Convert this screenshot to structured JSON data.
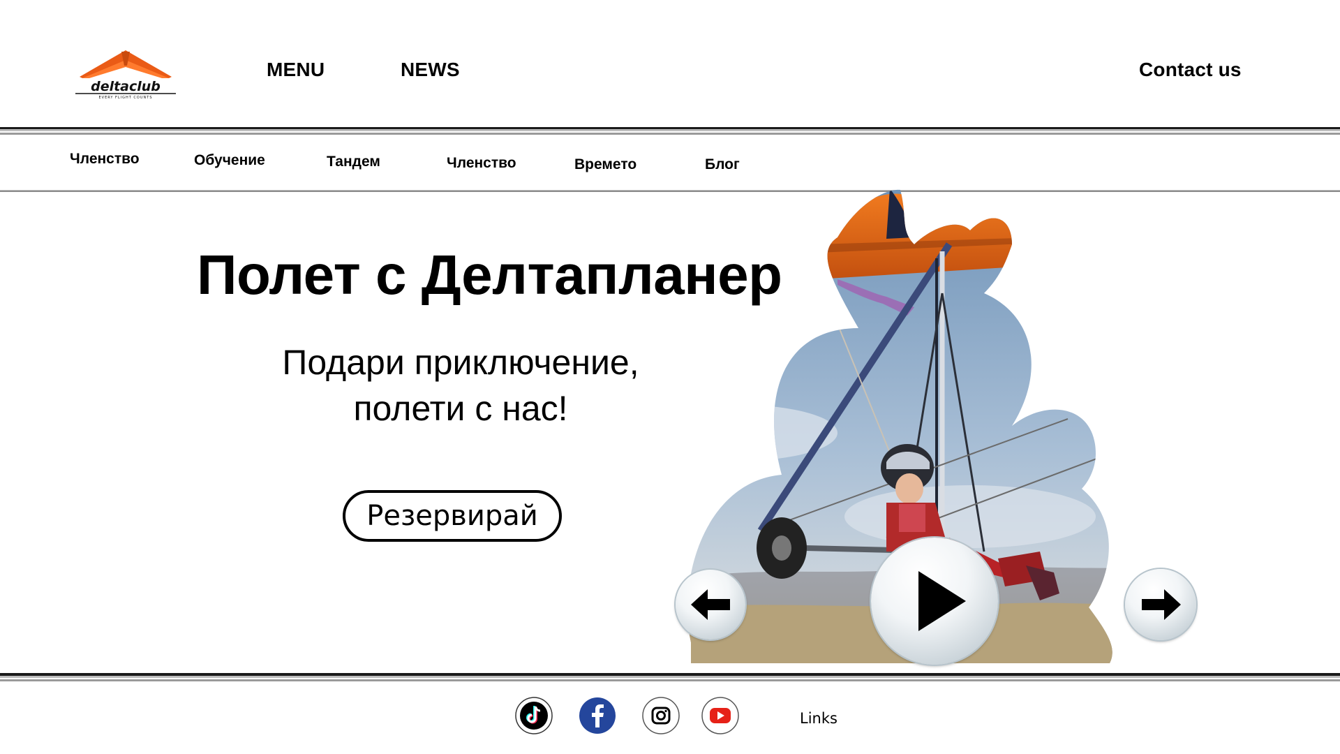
{
  "brand": {
    "name": "deltaclub",
    "tagline": "EVERY FLIGHT COUNTS",
    "accent_color": "#ea5b16",
    "logo_icon": "hang-glider-logo-icon"
  },
  "header": {
    "menu_label": "MENU",
    "news_label": "NEWS",
    "contact_label": "Contact us"
  },
  "subnav": {
    "items": [
      "Членство",
      "Обучение",
      "Тандем",
      "Членство",
      "Времето",
      "Блог"
    ]
  },
  "hero": {
    "title": "Полет с Делтапланер",
    "subtitle_line1": "Подари приключение,",
    "subtitle_line2": "полети с нас!",
    "cta_label": "Резервирай"
  },
  "slider": {
    "image_subject": "child flying a hang glider",
    "prev_icon": "arrow-left-icon",
    "play_icon": "play-icon",
    "next_icon": "arrow-right-icon"
  },
  "footer": {
    "social_icons": [
      "tiktok-icon",
      "facebook-icon",
      "instagram-icon",
      "youtube-icon"
    ],
    "links_label": "Links"
  }
}
